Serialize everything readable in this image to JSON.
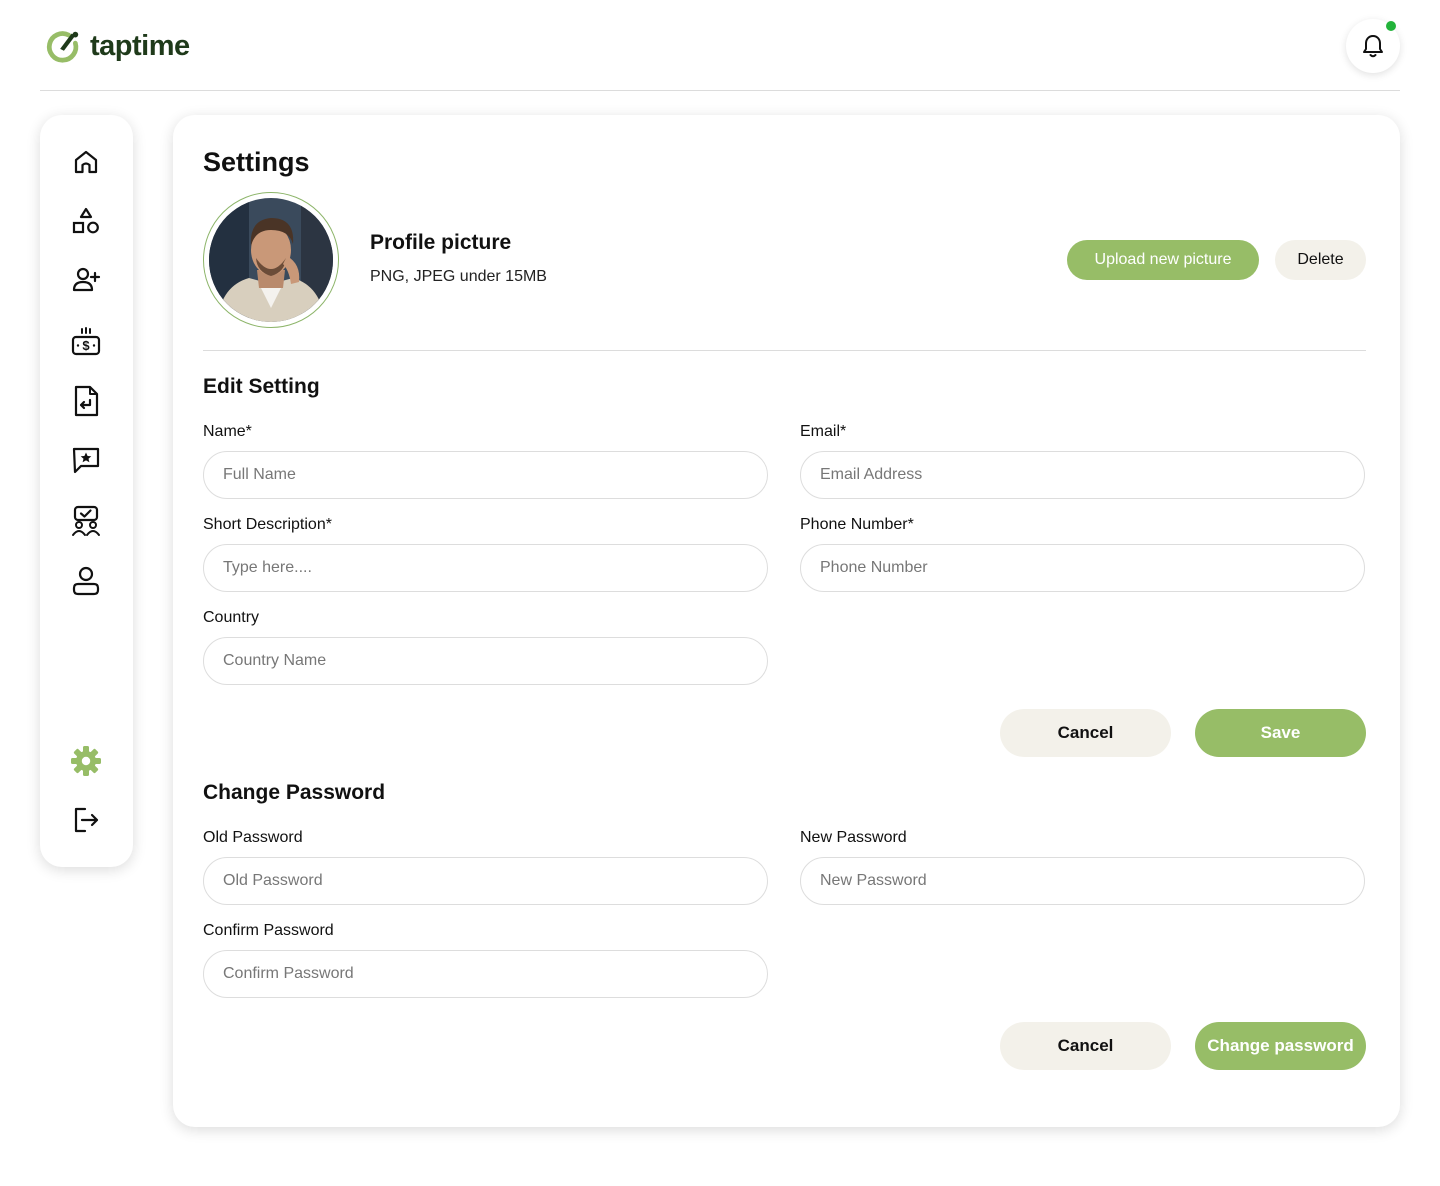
{
  "brand": {
    "name": "taptime",
    "accent": "#97bd67",
    "logo_color": "#1f3a1a"
  },
  "header": {
    "notification_icon": "bell-icon",
    "notification_dot_color": "#22b33a"
  },
  "sidebar": {
    "items": [
      {
        "name": "home",
        "icon": "home-icon"
      },
      {
        "name": "categories",
        "icon": "shapes-icon"
      },
      {
        "name": "add-user",
        "icon": "user-plus-icon"
      },
      {
        "name": "payments",
        "icon": "money-icon"
      },
      {
        "name": "documents",
        "icon": "file-return-icon"
      },
      {
        "name": "reviews",
        "icon": "star-message-icon"
      },
      {
        "name": "meetings",
        "icon": "group-check-icon"
      },
      {
        "name": "profile",
        "icon": "user-icon"
      },
      {
        "name": "settings",
        "icon": "gear-icon",
        "active": true
      },
      {
        "name": "logout",
        "icon": "logout-icon"
      }
    ]
  },
  "settings": {
    "title": "Settings",
    "profile": {
      "title": "Profile picture",
      "subtitle": "PNG, JPEG under 15MB",
      "upload_label": "Upload new picture",
      "delete_label": "Delete"
    },
    "edit": {
      "title": "Edit Setting",
      "name_label": "Name*",
      "name_placeholder": "Full Name",
      "email_label": "Email*",
      "email_placeholder": "Email Address",
      "desc_label": "Short Description*",
      "desc_placeholder": "Type here....",
      "phone_label": "Phone Number*",
      "phone_placeholder": "Phone Number",
      "country_label": "Country",
      "country_placeholder": "Country Name",
      "cancel_label": "Cancel",
      "save_label": "Save"
    },
    "password": {
      "title": "Change Password",
      "old_label": "Old Password",
      "old_placeholder": "Old Password",
      "new_label": "New Password",
      "new_placeholder": "New Password",
      "confirm_label": "Confirm Password",
      "confirm_placeholder": "Confirm Password",
      "cancel_label": "Cancel",
      "submit_label": "Change password"
    }
  }
}
